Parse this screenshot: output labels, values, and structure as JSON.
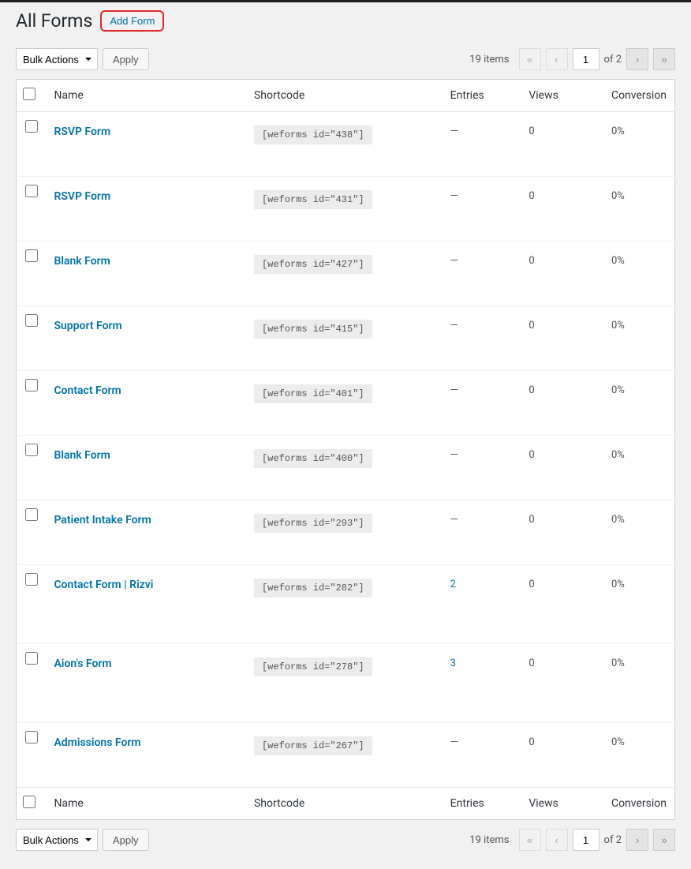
{
  "header": {
    "title": "All Forms",
    "add_button": "Add Form"
  },
  "bulk": {
    "label": "Bulk Actions",
    "apply": "Apply"
  },
  "pagination": {
    "items_text": "19 items",
    "first": "«",
    "prev": "‹",
    "current": "1",
    "total_text": "of 2",
    "next": "›",
    "last": "»"
  },
  "columns": {
    "name": "Name",
    "shortcode": "Shortcode",
    "entries": "Entries",
    "views": "Views",
    "conversion": "Conversion"
  },
  "rows": [
    {
      "name": "RSVP Form",
      "shortcode": "[weforms id=\"438\"]",
      "entries": "—",
      "views": "0",
      "conversion": "0%",
      "entries_link": false,
      "tall": false
    },
    {
      "name": "RSVP Form",
      "shortcode": "[weforms id=\"431\"]",
      "entries": "—",
      "views": "0",
      "conversion": "0%",
      "entries_link": false,
      "tall": false
    },
    {
      "name": "Blank Form",
      "shortcode": "[weforms id=\"427\"]",
      "entries": "—",
      "views": "0",
      "conversion": "0%",
      "entries_link": false,
      "tall": false
    },
    {
      "name": "Support Form",
      "shortcode": "[weforms id=\"415\"]",
      "entries": "—",
      "views": "0",
      "conversion": "0%",
      "entries_link": false,
      "tall": false
    },
    {
      "name": "Contact Form",
      "shortcode": "[weforms id=\"401\"]",
      "entries": "—",
      "views": "0",
      "conversion": "0%",
      "entries_link": false,
      "tall": false
    },
    {
      "name": "Blank Form",
      "shortcode": "[weforms id=\"400\"]",
      "entries": "—",
      "views": "0",
      "conversion": "0%",
      "entries_link": false,
      "tall": false
    },
    {
      "name": "Patient Intake Form",
      "shortcode": "[weforms id=\"293\"]",
      "entries": "—",
      "views": "0",
      "conversion": "0%",
      "entries_link": false,
      "tall": false
    },
    {
      "name": "Contact Form | Rizvi",
      "shortcode": "[weforms id=\"282\"]",
      "entries": "2",
      "views": "0",
      "conversion": "0%",
      "entries_link": true,
      "tall": true
    },
    {
      "name": "Aion's Form",
      "shortcode": "[weforms id=\"278\"]",
      "entries": "3",
      "views": "0",
      "conversion": "0%",
      "entries_link": true,
      "tall": true
    },
    {
      "name": "Admissions Form",
      "shortcode": "[weforms id=\"267\"]",
      "entries": "—",
      "views": "0",
      "conversion": "0%",
      "entries_link": false,
      "tall": false
    }
  ]
}
